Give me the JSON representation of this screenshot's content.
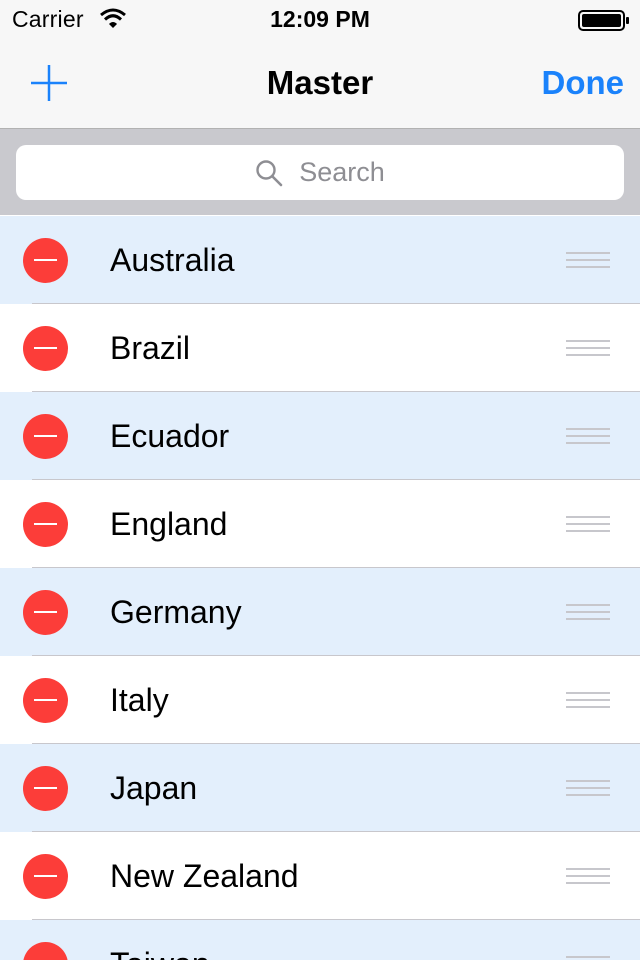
{
  "status_bar": {
    "carrier": "Carrier",
    "time": "12:09 PM",
    "wifi_icon": "wifi-icon",
    "battery_icon": "battery-full-icon"
  },
  "nav_bar": {
    "add_icon": "plus-icon",
    "title": "Master",
    "done_label": "Done"
  },
  "search": {
    "icon": "search-icon",
    "placeholder": "Search"
  },
  "list": {
    "items": [
      {
        "label": "Australia"
      },
      {
        "label": "Brazil"
      },
      {
        "label": "Ecuador"
      },
      {
        "label": "England"
      },
      {
        "label": "Germany"
      },
      {
        "label": "Italy"
      },
      {
        "label": "Japan"
      },
      {
        "label": "New Zealand"
      },
      {
        "label": "Taiwan"
      }
    ]
  },
  "colors": {
    "accent": "#1a82fb",
    "delete_red": "#fc3d39",
    "alt_row": "#e3effc",
    "search_bar_bg": "#c9c9ce",
    "nav_bg": "#f7f7f7"
  }
}
